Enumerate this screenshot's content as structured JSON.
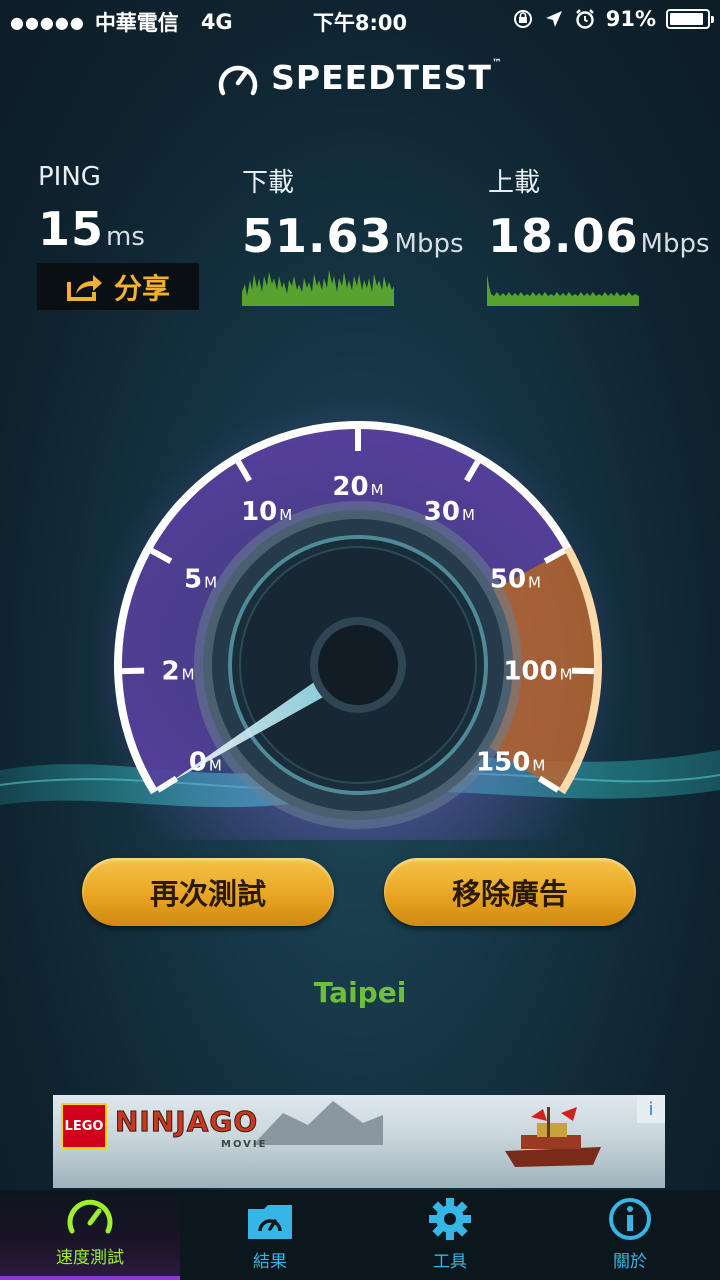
{
  "status_bar": {
    "signal": "●●●●●",
    "carrier": "中華電信",
    "network": "4G",
    "time": "下午8:00",
    "battery_percent": "91%",
    "battery_level": 0.91
  },
  "app": {
    "title": "SPEEDTEST",
    "trademark": "™"
  },
  "ping": {
    "label": "PING",
    "value": "15",
    "unit": "ms"
  },
  "download": {
    "label": "下載",
    "value": "51.63",
    "unit": "Mbps"
  },
  "upload": {
    "label": "上載",
    "value": "18.06",
    "unit": "Mbps"
  },
  "share_button": {
    "label": "分享"
  },
  "gauge": {
    "ticks": [
      {
        "num": "0",
        "unit": "M"
      },
      {
        "num": "2",
        "unit": "M"
      },
      {
        "num": "5",
        "unit": "M"
      },
      {
        "num": "10",
        "unit": "M"
      },
      {
        "num": "20",
        "unit": "M"
      },
      {
        "num": "30",
        "unit": "M"
      },
      {
        "num": "50",
        "unit": "M"
      },
      {
        "num": "100",
        "unit": "M"
      },
      {
        "num": "150",
        "unit": "M"
      }
    ],
    "needle_value": 0,
    "colors": {
      "arc_fill": "#5a3fa0",
      "over_fill": "#b8652e",
      "needle": "#bff4ff"
    }
  },
  "buttons": {
    "retest": "再次測試",
    "remove_ads": "移除廣告"
  },
  "location": "Taipei",
  "ad": {
    "brand": "LEGO",
    "title": "NINJAGO",
    "subtitle": "MOVIE",
    "info": "i"
  },
  "tabs": [
    {
      "label": "速度測試",
      "icon": "speedometer-icon",
      "active": true
    },
    {
      "label": "結果",
      "icon": "folder-results-icon",
      "active": false
    },
    {
      "label": "工具",
      "icon": "gear-icon",
      "active": false
    },
    {
      "label": "關於",
      "icon": "info-icon",
      "active": false
    }
  ],
  "colors": {
    "accent_gold": "#e9a521",
    "location_green": "#6fbf3a",
    "tab_blue": "#36b6e6",
    "tab_active": "#9cf02d"
  }
}
